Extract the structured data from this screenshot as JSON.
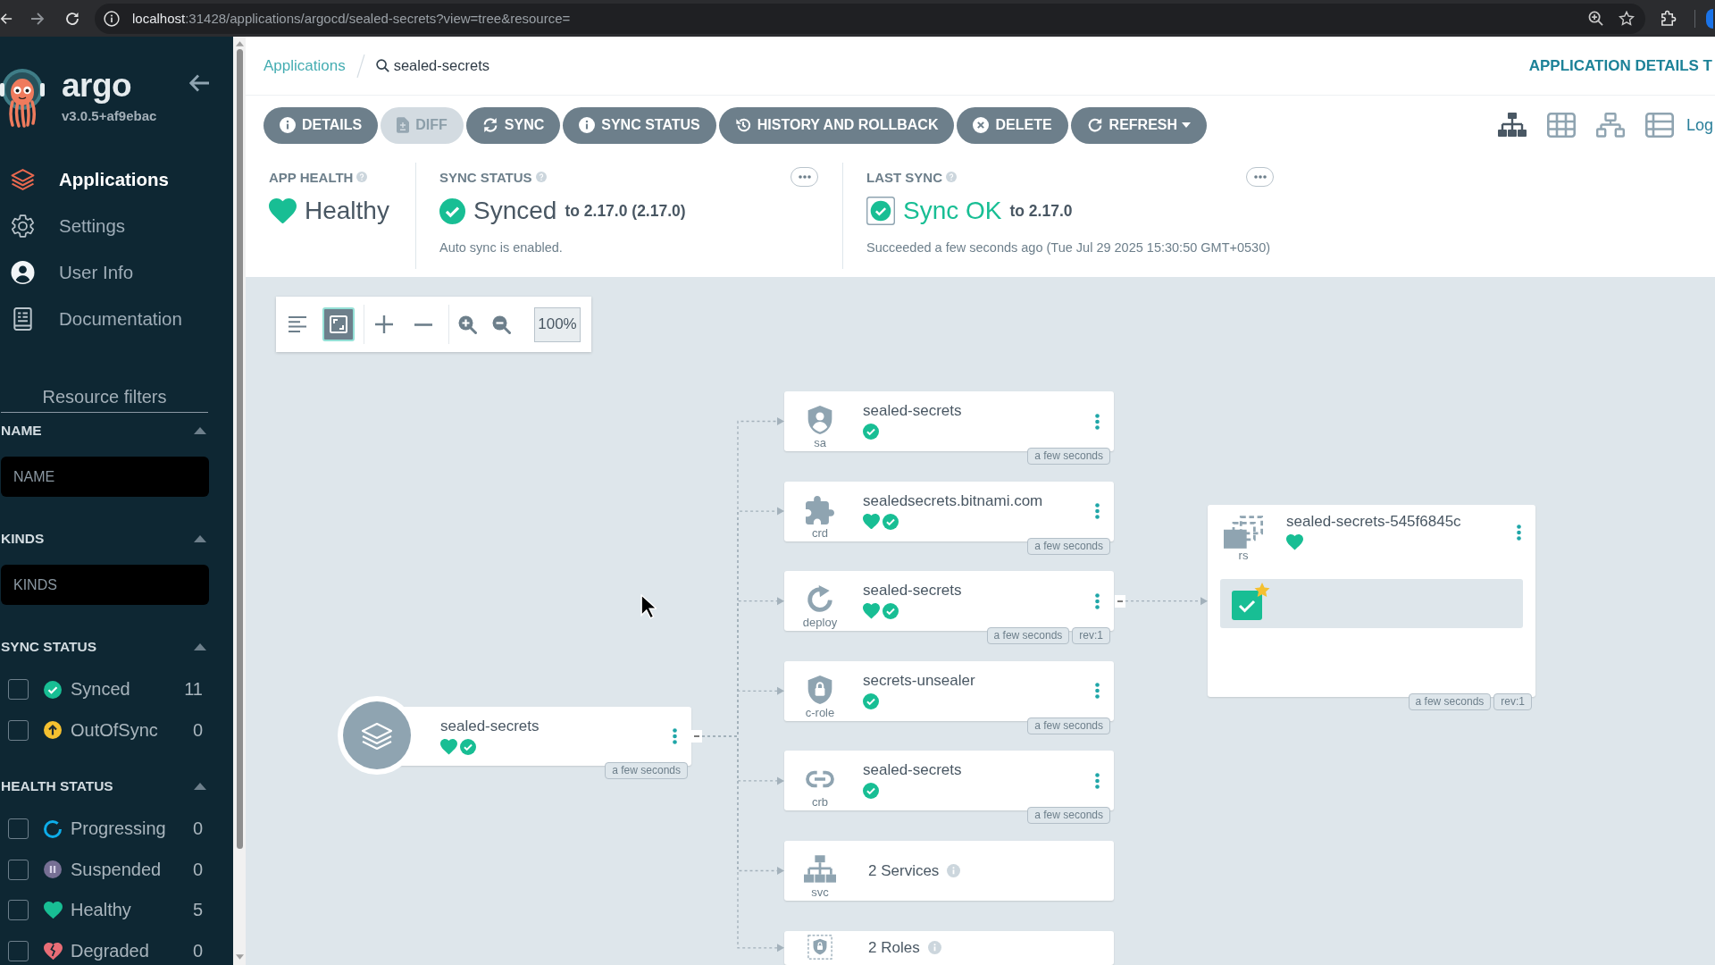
{
  "browser": {
    "url_host": "localhost",
    "url_path": ":31428/applications/argocd/sealed-secrets?view=tree&resource="
  },
  "sidebar": {
    "logo_text": "argo",
    "version": "v3.0.5+af9ebac",
    "nav": [
      {
        "kind": "applications",
        "label": "Applications",
        "selected": true
      },
      {
        "kind": "settings",
        "label": "Settings",
        "selected": false
      },
      {
        "kind": "user",
        "label": "User Info",
        "selected": false
      },
      {
        "kind": "docs",
        "label": "Documentation",
        "selected": false
      }
    ],
    "filters_title": "Resource filters",
    "filters": [
      {
        "kind": "text",
        "title": "NAME",
        "placeholder": "NAME",
        "expanded": true
      },
      {
        "kind": "text",
        "title": "KINDS",
        "placeholder": "KINDS",
        "expanded": true
      },
      {
        "kind": "checklist",
        "title": "SYNC STATUS",
        "expanded": true,
        "options": [
          {
            "kind": "synced",
            "label": "Synced",
            "count": "11",
            "checked": false
          },
          {
            "kind": "outofsync",
            "label": "OutOfSync",
            "count": "0",
            "checked": false
          }
        ]
      },
      {
        "kind": "checklist",
        "title": "HEALTH STATUS",
        "expanded": true,
        "options": [
          {
            "kind": "progressing",
            "label": "Progressing",
            "count": "0",
            "checked": false
          },
          {
            "kind": "suspended",
            "label": "Suspended",
            "count": "0",
            "checked": false
          },
          {
            "kind": "healthy",
            "label": "Healthy",
            "count": "5",
            "checked": false
          },
          {
            "kind": "degraded",
            "label": "Degraded",
            "count": "0",
            "checked": false
          }
        ]
      }
    ]
  },
  "breadcrumbs": [
    {
      "kind": "link",
      "label": "Applications"
    },
    {
      "kind": "search",
      "label": "sealed-secrets"
    }
  ],
  "page_title": "APPLICATION DETAILS T",
  "actions": [
    {
      "kind": "details",
      "label": "DETAILS",
      "disabled": false,
      "dropdown": false
    },
    {
      "kind": "diff",
      "label": "DIFF",
      "disabled": true,
      "dropdown": false
    },
    {
      "kind": "sync",
      "label": "SYNC",
      "disabled": false,
      "dropdown": false
    },
    {
      "kind": "sync_status",
      "label": "SYNC STATUS",
      "disabled": false,
      "dropdown": false
    },
    {
      "kind": "history",
      "label": "HISTORY AND ROLLBACK",
      "disabled": false,
      "dropdown": false
    },
    {
      "kind": "delete",
      "label": "DELETE",
      "disabled": false,
      "dropdown": false
    },
    {
      "kind": "refresh",
      "label": "REFRESH",
      "disabled": false,
      "dropdown": true
    }
  ],
  "view_modes": [
    {
      "kind": "tree",
      "selected": true
    },
    {
      "kind": "pods",
      "selected": false
    },
    {
      "kind": "network",
      "selected": false
    },
    {
      "kind": "list",
      "selected": false
    }
  ],
  "logs_link": "Log",
  "status": {
    "app_health": {
      "title": "APP HEALTH",
      "healthy": true,
      "value": "Healthy"
    },
    "sync_status": {
      "title": "SYNC STATUS",
      "synced": true,
      "value": "Synced",
      "target": "to 2.17.0 (2.17.0)",
      "note": "Auto sync is enabled."
    },
    "last_sync": {
      "title": "LAST SYNC",
      "succeeded": true,
      "value": "Sync OK",
      "target": "to 2.17.0",
      "note": "Succeeded a few seconds ago (Tue Jul 29 2025 15:30:50 GMT+0530)"
    }
  },
  "graph": {
    "toolbar": {
      "toggles": [
        {
          "kind": "compact",
          "selected": false
        },
        {
          "kind": "fit",
          "selected": true
        }
      ],
      "zoom": "100%"
    },
    "root": {
      "name": "sealed-secrets",
      "healthy": true,
      "synced": true,
      "age": "a few seconds",
      "expanded": true,
      "children": [
        {
          "kind": "serviceaccount",
          "kind_label": "sa",
          "name": "sealed-secrets",
          "group": false,
          "synced": true,
          "age": "a few seconds"
        },
        {
          "kind": "customresourcedefinition",
          "kind_label": "crd",
          "name": "sealedsecrets.bitnami.com",
          "group": false,
          "healthy": true,
          "synced": true,
          "age": "a few seconds"
        },
        {
          "kind": "deployment",
          "kind_label": "deploy",
          "name": "sealed-secrets",
          "group": false,
          "healthy": true,
          "synced": true,
          "age": "a few seconds",
          "revision": "rev:1",
          "expanded": true,
          "children": [
            {
              "kind": "replicaset",
              "kind_label": "rs",
              "name": "sealed-secrets-545f6845c",
              "healthy": true,
              "age": "a few seconds",
              "revision": "rev:1",
              "pods": [
                {
                  "healthy": true,
                  "starred": true
                }
              ]
            }
          ]
        },
        {
          "kind": "clusterrole",
          "kind_label": "c-role",
          "name": "secrets-unsealer",
          "group": false,
          "synced": true,
          "age": "a few seconds"
        },
        {
          "kind": "clusterrolebinding",
          "kind_label": "crb",
          "name": "sealed-secrets",
          "group": false,
          "synced": true,
          "age": "a few seconds"
        },
        {
          "kind": "service",
          "kind_label": "svc",
          "name": "2 Services",
          "group": true
        },
        {
          "kind": "role",
          "name": "2 Roles",
          "group": true
        }
      ]
    }
  }
}
